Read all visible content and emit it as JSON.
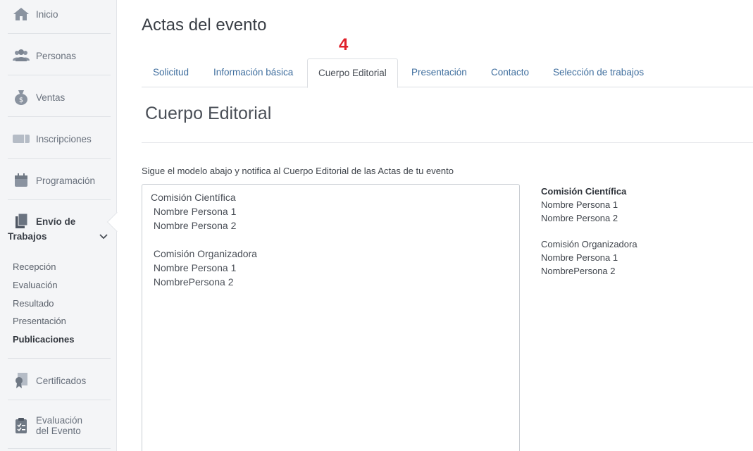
{
  "sidebar": {
    "items": [
      {
        "label": "Inicio",
        "icon": "home-icon"
      },
      {
        "label": "Personas",
        "icon": "people-icon"
      },
      {
        "label": "Ventas",
        "icon": "money-bag-icon"
      },
      {
        "label": "Inscripciones",
        "icon": "ticket-icon"
      },
      {
        "label": "Programación",
        "icon": "calendar-icon"
      },
      {
        "label": "Envío de Trabajos",
        "icon": "documents-icon"
      },
      {
        "label": "Certificados",
        "icon": "certificate-icon"
      },
      {
        "label": "Evaluación del Evento",
        "icon": "clipboard-icon"
      }
    ],
    "submenu": [
      "Recepción",
      "Evaluación",
      "Resultado",
      "Presentación",
      "Publicaciones"
    ],
    "active_submenu": "Publicaciones"
  },
  "page": {
    "title": "Actas del evento",
    "step_marker": "4"
  },
  "tabs": [
    {
      "label": "Solicitud"
    },
    {
      "label": "Información básica"
    },
    {
      "label": "Cuerpo Editorial",
      "active": true
    },
    {
      "label": "Presentación"
    },
    {
      "label": "Contacto"
    },
    {
      "label": "Selección de trabajos"
    }
  ],
  "section": {
    "title": "Cuerpo Editorial",
    "instructions": "Sigue el modelo abajo y notifica al Cuerpo Editorial de las Actas de tu evento"
  },
  "editor": {
    "lines": [
      "Comisión Científica",
      " Nombre Persona 1",
      " Nombre Persona 2",
      "",
      " Comisión Organizadora",
      " Nombre Persona 1",
      " NombrePersona 2"
    ]
  },
  "preview": {
    "heading": "Comisión Científica",
    "lines1": [
      "Nombre Persona 1",
      "Nombre Persona 2"
    ],
    "lines2": [
      "Comisión Organizadora",
      "Nombre Persona 1",
      "NombrePersona 2"
    ]
  },
  "colors": {
    "link": "#3f6e9e",
    "marker": "#e0202a",
    "sidebar_bg": "#f4f5f7"
  }
}
